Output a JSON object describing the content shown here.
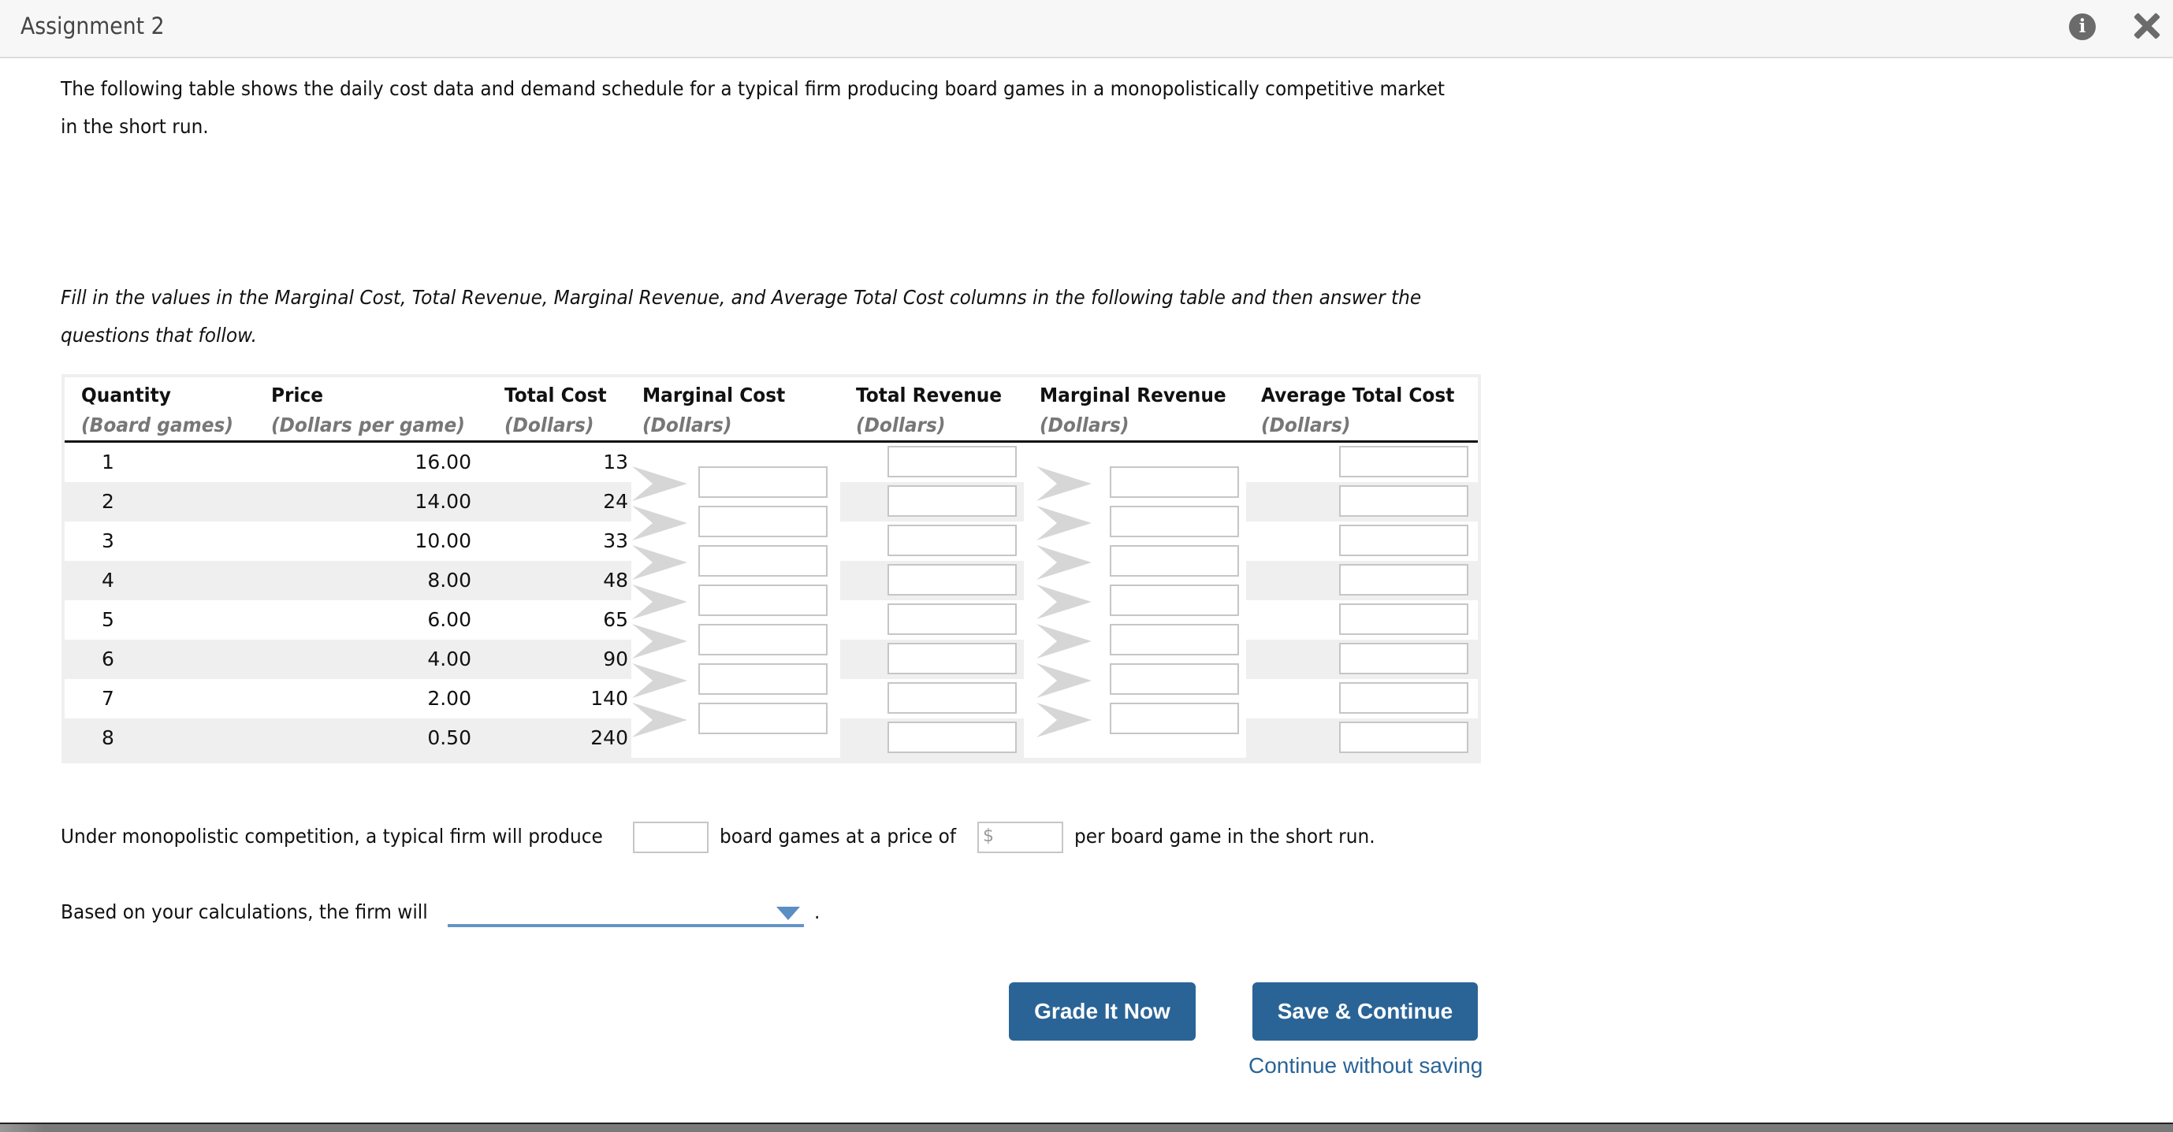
{
  "header": {
    "title": "Assignment 2",
    "info_icon": "info-icon",
    "close_icon": "close-icon"
  },
  "intro": {
    "line1": "The following table shows the daily cost data and demand schedule for a typical firm producing board games in a monopolistically competitive market",
    "line2": "in the short run."
  },
  "instructions": {
    "line1": "Fill in the values in the Marginal Cost, Total Revenue, Marginal Revenue, and Average Total Cost columns in the following table and then answer the",
    "line2": "questions that follow."
  },
  "table": {
    "columns": [
      {
        "title": "Quantity",
        "unit": "(Board games)"
      },
      {
        "title": "Price",
        "unit": "(Dollars per game)"
      },
      {
        "title": "Total Cost",
        "unit": "(Dollars)"
      },
      {
        "title": "Marginal Cost",
        "unit": "(Dollars)"
      },
      {
        "title": "Total Revenue",
        "unit": "(Dollars)"
      },
      {
        "title": "Marginal Revenue",
        "unit": "(Dollars)"
      },
      {
        "title": "Average Total Cost",
        "unit": "(Dollars)"
      }
    ],
    "rows": [
      {
        "quantity": "1",
        "price": "16.00",
        "total_cost": "13",
        "total_revenue": "",
        "average_total_cost": ""
      },
      {
        "quantity": "2",
        "price": "14.00",
        "total_cost": "24",
        "total_revenue": "",
        "average_total_cost": ""
      },
      {
        "quantity": "3",
        "price": "10.00",
        "total_cost": "33",
        "total_revenue": "",
        "average_total_cost": ""
      },
      {
        "quantity": "4",
        "price": "8.00",
        "total_cost": "48",
        "total_revenue": "",
        "average_total_cost": ""
      },
      {
        "quantity": "5",
        "price": "6.00",
        "total_cost": "65",
        "total_revenue": "",
        "average_total_cost": ""
      },
      {
        "quantity": "6",
        "price": "4.00",
        "total_cost": "90",
        "total_revenue": "",
        "average_total_cost": ""
      },
      {
        "quantity": "7",
        "price": "2.00",
        "total_cost": "140",
        "total_revenue": "",
        "average_total_cost": ""
      },
      {
        "quantity": "8",
        "price": "0.50",
        "total_cost": "240",
        "total_revenue": "",
        "average_total_cost": ""
      }
    ],
    "marginal_cost_inputs": [
      "",
      "",
      "",
      "",
      "",
      "",
      ""
    ],
    "marginal_revenue_inputs": [
      "",
      "",
      "",
      "",
      "",
      "",
      ""
    ]
  },
  "question1": {
    "part1": "Under monopolistic competition, a typical firm will produce",
    "quantity_value": "",
    "part2": "board games at a price of",
    "price_prefix": "$",
    "price_value": "",
    "part3": "per board game in the short run."
  },
  "question2": {
    "text": "Based on your calculations, the firm will",
    "selected": "",
    "end": "."
  },
  "actions": {
    "grade_label": "Grade It Now",
    "save_label": "Save & Continue",
    "continue_link": "Continue without saving"
  },
  "colors": {
    "button": "#2a6496",
    "dropdown_accent": "#6495c5",
    "stripe": "#efefef"
  }
}
